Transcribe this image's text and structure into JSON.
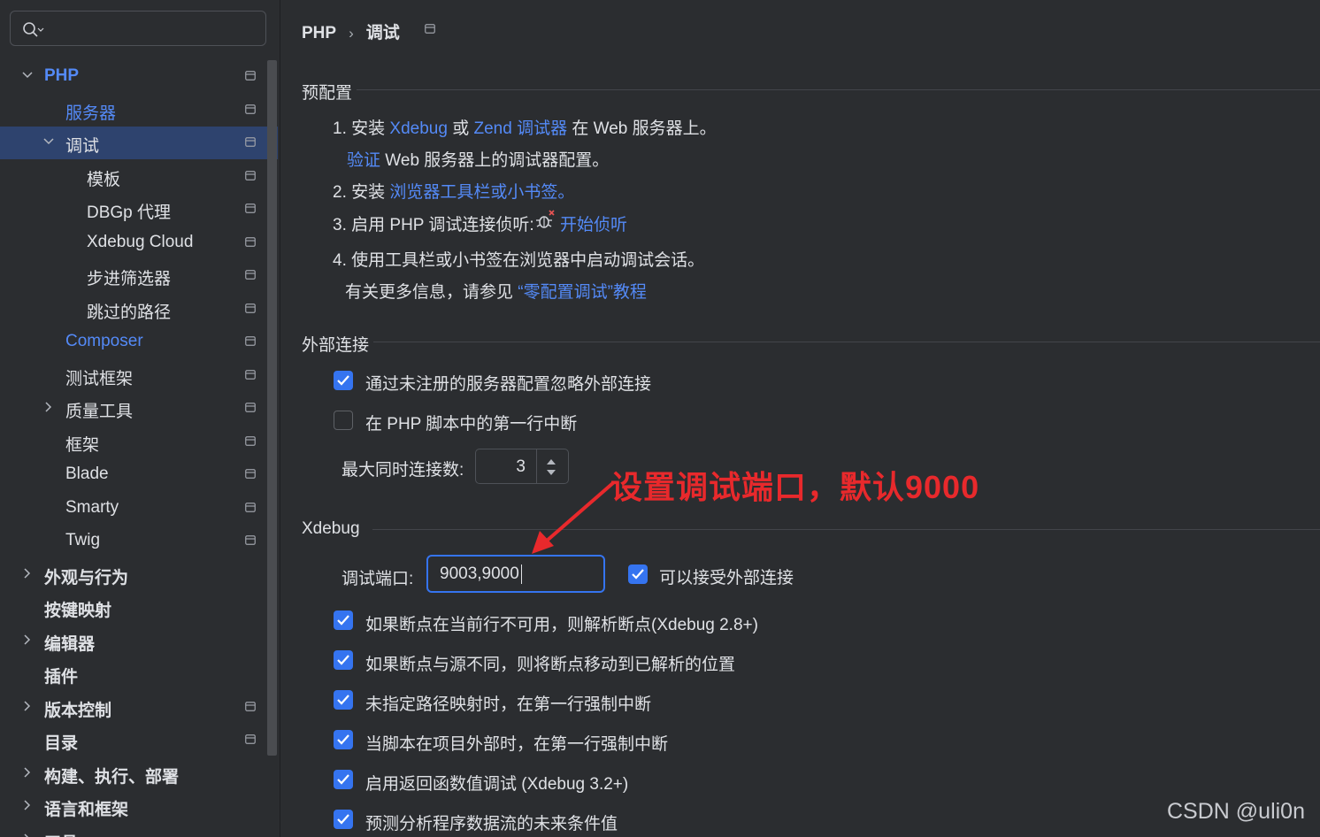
{
  "search": {
    "placeholder": ""
  },
  "sidebar": {
    "items": [
      {
        "label": "PHP",
        "expanded": true
      },
      {
        "label": "服务器"
      },
      {
        "label": "调试",
        "expanded": true,
        "selected": true
      },
      {
        "label": "模板"
      },
      {
        "label": "DBGp 代理"
      },
      {
        "label": "Xdebug Cloud"
      },
      {
        "label": "步进筛选器"
      },
      {
        "label": "跳过的路径"
      },
      {
        "label": "Composer"
      },
      {
        "label": "测试框架"
      },
      {
        "label": "质量工具",
        "expanded": false
      },
      {
        "label": "框架"
      },
      {
        "label": "Blade"
      },
      {
        "label": "Smarty"
      },
      {
        "label": "Twig"
      },
      {
        "label": "外观与行为",
        "expanded": false
      },
      {
        "label": "按键映射"
      },
      {
        "label": "编辑器",
        "expanded": false
      },
      {
        "label": "插件"
      },
      {
        "label": "版本控制",
        "expanded": false
      },
      {
        "label": "目录"
      },
      {
        "label": "构建、执行、部署",
        "expanded": false
      },
      {
        "label": "语言和框架",
        "expanded": false
      },
      {
        "label": "工具"
      }
    ]
  },
  "breadcrumb": {
    "parent": "PHP",
    "current": "调试"
  },
  "preconfig": {
    "title": "预配置",
    "step1_prefix": "1. 安装 ",
    "step1_link1": "Xdebug",
    "step1_or": " 或 ",
    "step1_link2": "Zend 调试器",
    "step1_suffix": " 在 Web 服务器上。",
    "verify_link": "验证",
    "verify_suffix": " Web 服务器上的调试器配置。",
    "step2_prefix": "2. 安装 ",
    "step2_link": "浏览器工具栏或小书签。",
    "step3_prefix": "3. 启用 PHP 调试连接侦听: ",
    "step3_link": "开始侦听",
    "step4": "4. 使用工具栏或小书签在浏览器中启动调试会话。",
    "more_prefix": "有关更多信息，请参见 ",
    "more_link": "“零配置调试”教程"
  },
  "external": {
    "title": "外部连接",
    "opt1": {
      "label": "通过未注册的服务器配置忽略外部连接",
      "checked": true
    },
    "opt2": {
      "label": "在 PHP 脚本中的第一行中断",
      "checked": false
    },
    "max_label": "最大同时连接数:",
    "max_value": "3"
  },
  "xdebug": {
    "title": "Xdebug",
    "port_label": "调试端口:",
    "port_value": "9003,9000",
    "accept_external": {
      "label": "可以接受外部连接",
      "checked": true
    },
    "options": [
      {
        "label": "如果断点在当前行不可用，则解析断点(Xdebug 2.8+)",
        "checked": true
      },
      {
        "label": "如果断点与源不同，则将断点移动到已解析的位置",
        "checked": true
      },
      {
        "label": "未指定路径映射时，在第一行强制中断",
        "checked": true
      },
      {
        "label": "当脚本在项目外部时，在第一行强制中断",
        "checked": true
      },
      {
        "label": "启用返回函数值调试 (Xdebug 3.2+)",
        "checked": true
      },
      {
        "label": "预测分析程序数据流的未来条件值",
        "checked": true
      }
    ]
  },
  "annotation": {
    "text": "设置调试端口，默认9000",
    "color": "#e8292c"
  },
  "watermark": "CSDN @uli0n",
  "colors": {
    "accent": "#3574f0",
    "link": "#548af7",
    "selection": "#2e436e",
    "background": "#2b2d30"
  }
}
